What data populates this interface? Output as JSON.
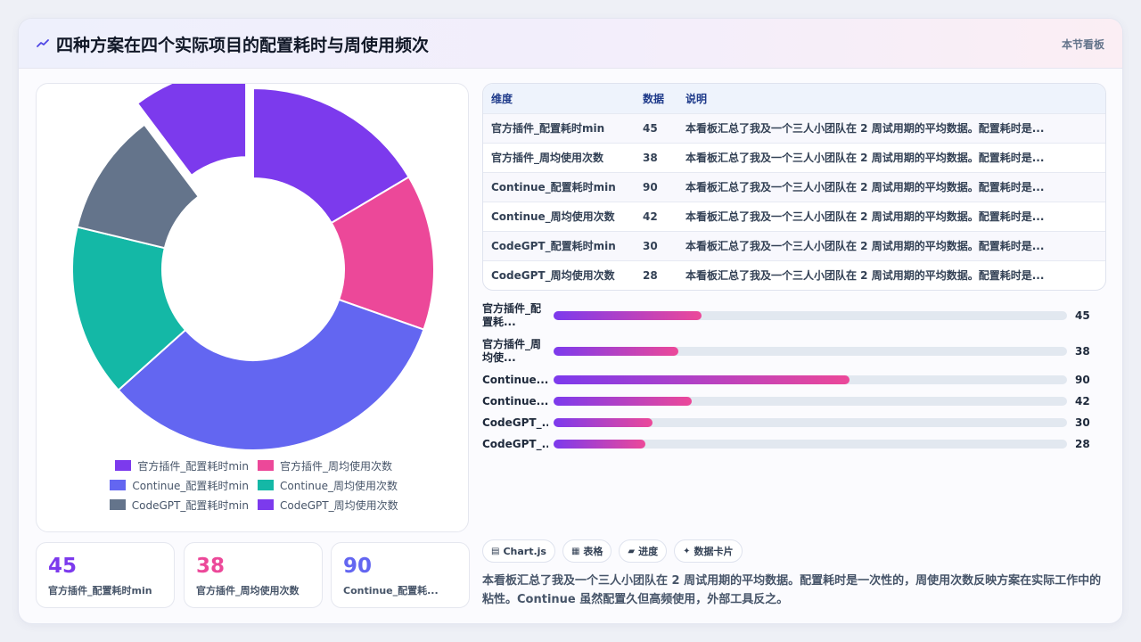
{
  "header": {
    "title": "四种方案在四个实际项目的配置耗时与周使用频次",
    "tag": "本节看板"
  },
  "colors": {
    "purple": "#7c3aed",
    "pink": "#ec4899",
    "indigo": "#6366f1",
    "teal": "#14b8a6",
    "slate": "#64748b",
    "violet": "#7c3aed"
  },
  "chart_data": {
    "type": "pie",
    "variant": "doughnut",
    "labels": [
      "官方插件_配置耗时min",
      "官方插件_周均使用次数",
      "Continue_配置耗时min",
      "Continue_周均使用次数",
      "CodeGPT_配置耗时min",
      "CodeGPT_周均使用次数"
    ],
    "values": [
      45,
      38,
      90,
      42,
      30,
      28
    ],
    "colors": [
      "#7c3aed",
      "#ec4899",
      "#6366f1",
      "#14b8a6",
      "#64748b",
      "#7c3aed"
    ],
    "exploded_index": 5,
    "legend_position": "bottom"
  },
  "kpis": [
    {
      "value": "45",
      "label": "官方插件_配置耗时min",
      "color": "#7c3aed"
    },
    {
      "value": "38",
      "label": "官方插件_周均使用次数",
      "color": "#ec4899"
    },
    {
      "value": "90",
      "label": "Continue_配置耗...",
      "color": "#6366f1"
    }
  ],
  "table": {
    "headers": [
      "维度",
      "数据",
      "说明"
    ],
    "rows": [
      [
        "官方插件_配置耗时min",
        "45",
        "本看板汇总了我及一个三人小团队在 2 周试用期的平均数据。配置耗时是..."
      ],
      [
        "官方插件_周均使用次数",
        "38",
        "本看板汇总了我及一个三人小团队在 2 周试用期的平均数据。配置耗时是..."
      ],
      [
        "Continue_配置耗时min",
        "90",
        "本看板汇总了我及一个三人小团队在 2 周试用期的平均数据。配置耗时是..."
      ],
      [
        "Continue_周均使用次数",
        "42",
        "本看板汇总了我及一个三人小团队在 2 周试用期的平均数据。配置耗时是..."
      ],
      [
        "CodeGPT_配置耗时min",
        "30",
        "本看板汇总了我及一个三人小团队在 2 周试用期的平均数据。配置耗时是..."
      ],
      [
        "CodeGPT_周均使用次数",
        "28",
        "本看板汇总了我及一个三人小团队在 2 周试用期的平均数据。配置耗时是..."
      ]
    ]
  },
  "progress": {
    "max": 90,
    "items": [
      {
        "label": "官方插件_配置耗...",
        "value": 45
      },
      {
        "label": "官方插件_周均使...",
        "value": 38
      },
      {
        "label": "Continue...",
        "value": 90
      },
      {
        "label": "Continue...",
        "value": 42
      },
      {
        "label": "CodeGPT_...",
        "value": 30
      },
      {
        "label": "CodeGPT_...",
        "value": 28
      }
    ]
  },
  "chips": [
    {
      "icon": "chart-icon",
      "glyph": "▤",
      "label": "Chart.js"
    },
    {
      "icon": "table-icon",
      "glyph": "▦",
      "label": "表格"
    },
    {
      "icon": "progress-icon",
      "glyph": "▰",
      "label": "进度"
    },
    {
      "icon": "sparkle-icon",
      "glyph": "✦",
      "label": "数据卡片"
    }
  ],
  "description": "本看板汇总了我及一个三人小团队在 2 周试用期的平均数据。配置耗时是一次性的，周使用次数反映方案在实际工作中的粘性。Continue 虽然配置久但高频使用，外部工具反之。"
}
